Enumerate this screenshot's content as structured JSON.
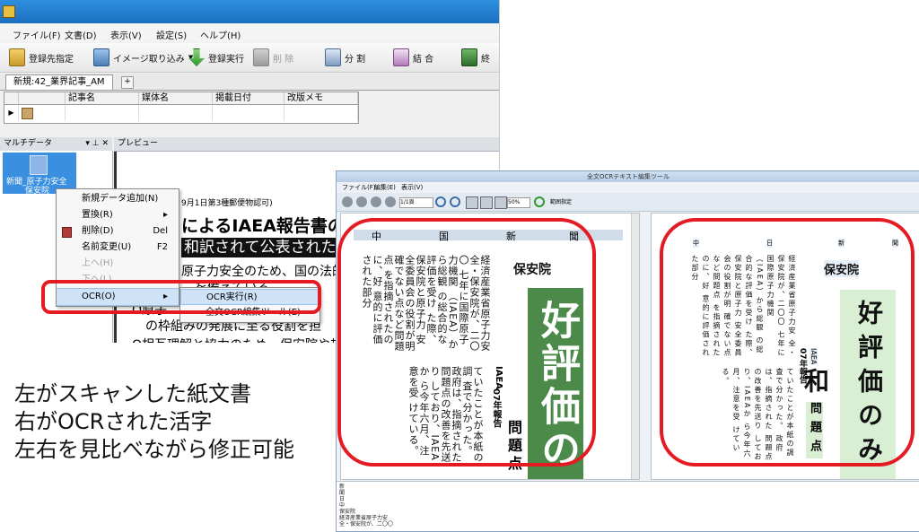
{
  "main_window": {
    "menu": [
      "ファイル(F)",
      "文書(D)",
      "表示(V)",
      "設定(S)",
      "ヘルプ(H)"
    ],
    "toolbar": {
      "register_target": "登録先指定",
      "image_import": "イメージ取り込み",
      "register_run": "登録実行",
      "delete": "削 除",
      "split": "分 割",
      "merge": "結 合",
      "end": "終"
    },
    "document_tab": "新規:42_業界記事_AM",
    "add_tab": "+",
    "grid_columns": [
      "記事名",
      "媒体名",
      "掲載日付",
      "改版メモ"
    ],
    "left_panel": {
      "title": "マルチデータ",
      "pin": "▾ ⊥ ✕",
      "item_label_1": "新聞_原子力安全",
      "item_label_2": "保安院"
    },
    "preview_panel": {
      "title": "プレビュー"
    },
    "preview_lines": [
      "9月1日第3種郵便物認可)",
      "によるIAEA報告書の公",
      "和訳されて公表された部分",
      "原子力安全のため、国の法的",
      "を備えている",
      "O原子",
      "の枠組みの発展に至る役割を担",
      "O相互理解と協力のため、保安院や規"
    ],
    "context_menu": {
      "items": [
        {
          "label": "新規データ追加(N)",
          "shortcut": "",
          "disabled": false
        },
        {
          "label": "置換(R)",
          "shortcut": "▸",
          "disabled": false
        },
        {
          "label": "削除(D)",
          "shortcut": "Del",
          "disabled": false
        },
        {
          "label": "名前変更(U)",
          "shortcut": "F2",
          "disabled": false
        },
        {
          "label": "上へ(H)",
          "shortcut": "",
          "disabled": true
        },
        {
          "label": "下へ(L)",
          "shortcut": "",
          "disabled": true
        },
        {
          "label": "OCR(O)",
          "shortcut": "▸",
          "disabled": false
        }
      ]
    },
    "submenu": {
      "run": "OCR実行(R)",
      "full_text": "全文OCR編集ツール(E)"
    }
  },
  "ocr_window": {
    "title": "全文OCRテキスト編集ツール",
    "menu": [
      "ファイル(F)",
      "編集(E)",
      "表示(V)"
    ],
    "page": "1/1頁",
    "zoom": "50%",
    "range_label": "範囲指定",
    "left_header": [
      "中",
      "国",
      "新",
      "聞"
    ],
    "right_header": [
      "中",
      "日",
      "新",
      "聞"
    ],
    "agency": "保安院",
    "big_title": "好評価のみ和",
    "sub_title": "問題点",
    "report_label": "07年報告",
    "iaea_label": "IAEA",
    "columns": [
      "経済産業省原子力安",
      "全・保安院が、二〇〇",
      "七年に国際原子力機関",
      "（IAEA）から総観",
      "の総合的な評価を受け",
      "た際、保安院と原子力",
      "安全委員会の役割が明",
      "確でない点など問題点",
      "を指摘されたのに、好",
      "意的に評価された部分"
    ],
    "columns_b": [
      "ていたことが本紙の調",
      "査で分かった。",
      "政府は、指摘された",
      "問題点の改善を先送り",
      "しており、IAEAか",
      "ら今年六月、注意を受",
      "けている。"
    ],
    "text_pane_lines": [
      "新",
      "聞",
      "日",
      "中",
      "",
      "保安院",
      "経済産業省原子力安",
      "全・保安院が、二〇〇",
      "七年に国際原子力機関",
      "(IAEA)から総観"
    ]
  },
  "caption": {
    "line1": "左がスキャンした紙文書",
    "line2": "右がOCRされた活字",
    "line3": "左右を見比べながら修正可能"
  },
  "colors": {
    "highlight": "#e41b23",
    "selection": "#3a8fe0",
    "green_fill": "#7fbf7a"
  }
}
